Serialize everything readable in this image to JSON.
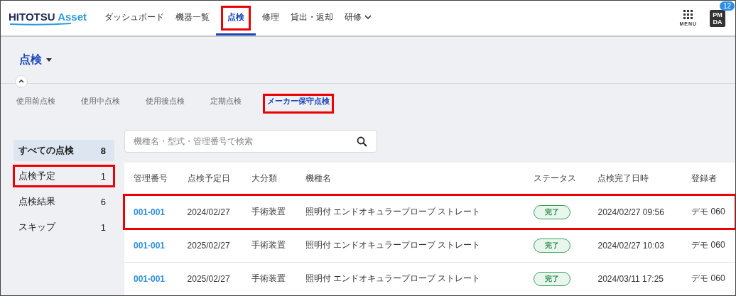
{
  "header": {
    "logo": {
      "brand": "HITOTSU",
      "product": "Asset"
    },
    "nav": [
      {
        "label": "ダッシュボード",
        "selected": false,
        "highlighted": false,
        "dropdown": false
      },
      {
        "label": "機器一覧",
        "selected": false,
        "highlighted": false,
        "dropdown": false
      },
      {
        "label": "点検",
        "selected": true,
        "highlighted": true,
        "dropdown": false
      },
      {
        "label": "修理",
        "selected": false,
        "highlighted": false,
        "dropdown": false
      },
      {
        "label": "貸出・返却",
        "selected": false,
        "highlighted": false,
        "dropdown": false
      },
      {
        "label": "研修",
        "selected": false,
        "highlighted": false,
        "dropdown": true
      }
    ],
    "menu_label": "MENU",
    "app_icon": {
      "top": "PM",
      "bottom": "DA",
      "badge": "12"
    }
  },
  "page_title": "点検",
  "tabs": [
    {
      "label": "使用前点検",
      "selected": false,
      "highlighted": false
    },
    {
      "label": "使用中点検",
      "selected": false,
      "highlighted": false
    },
    {
      "label": "使用後点検",
      "selected": false,
      "highlighted": false
    },
    {
      "label": "定期点検",
      "selected": false,
      "highlighted": false
    },
    {
      "label": "メーカー保守点検",
      "selected": true,
      "highlighted": true
    }
  ],
  "sidebar": {
    "items": [
      {
        "label": "すべての点検",
        "count": "8",
        "selected": true,
        "highlighted": false
      },
      {
        "label": "点検予定",
        "count": "1",
        "selected": false,
        "highlighted": true
      },
      {
        "label": "点検結果",
        "count": "6",
        "selected": false,
        "highlighted": false
      },
      {
        "label": "スキップ",
        "count": "1",
        "selected": false,
        "highlighted": false
      }
    ]
  },
  "search": {
    "placeholder": "機種名・型式・管理番号で検索"
  },
  "table": {
    "columns": [
      "管理番号",
      "点検予定日",
      "大分類",
      "機種名",
      "ステータス",
      "点検完了日時",
      "登録者"
    ],
    "rows": [
      {
        "id": "001-001",
        "scheduled": "2024/02/27",
        "category": "手術装置",
        "model": "照明付 エンドオキュラープローブ ストレート",
        "status": "完了",
        "completed": "2024/02/27 09:56",
        "registrant": "デモ 060",
        "highlighted": true
      },
      {
        "id": "001-001",
        "scheduled": "2025/02/27",
        "category": "手術装置",
        "model": "照明付 エンドオキュラープローブ ストレート",
        "status": "完了",
        "completed": "2024/02/27 10:03",
        "registrant": "デモ 060",
        "highlighted": false
      },
      {
        "id": "001-001",
        "scheduled": "2025/02/27",
        "category": "手術装置",
        "model": "照明付 エンドオキュラープローブ ストレート",
        "status": "完了",
        "completed": "2024/03/11 17:25",
        "registrant": "デモ 060",
        "highlighted": false
      }
    ]
  }
}
